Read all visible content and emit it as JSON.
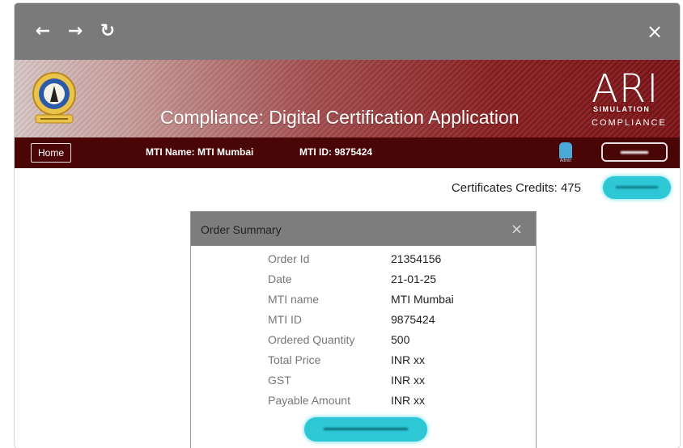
{
  "toolbar": {
    "back_icon": "←",
    "forward_icon": "→",
    "reload_icon": "↻",
    "close_icon": "×"
  },
  "header": {
    "title": "Compliance: Digital Certification Application",
    "logo": {
      "mark": "ARI",
      "line1": "SIMULATION",
      "line2": "COMPLIANCE"
    },
    "emblem": "dg-shipping-emblem"
  },
  "menubar": {
    "home_label": "Home",
    "mti_name": "MTI Name: MTI Mumbai",
    "mti_id": "MTI ID: 9875424",
    "admin_label": "Admin"
  },
  "credits": {
    "text": "Certificates Credits: 475"
  },
  "modal": {
    "title": "Order Summary",
    "close_icon": "×",
    "rows": [
      {
        "label": "Order Id",
        "value": "21354156"
      },
      {
        "label": "Date",
        "value": "21-01-25"
      },
      {
        "label": "MTI name",
        "value": "MTI Mumbai"
      },
      {
        "label": "MTI ID",
        "value": "9875424"
      },
      {
        "label": "Ordered Quantity",
        "value": "500"
      },
      {
        "label": "Total Price",
        "value": "INR xx"
      },
      {
        "label": "GST",
        "value": "INR xx"
      },
      {
        "label": "Payable Amount",
        "value": "INR xx"
      }
    ]
  },
  "colors": {
    "topbar": "#7a7a7a",
    "menubar": "#4a0607",
    "banner_dark": "#7b1417",
    "accent_cyan": "#2ec7d6",
    "modal_header": "#7d7d7d"
  }
}
